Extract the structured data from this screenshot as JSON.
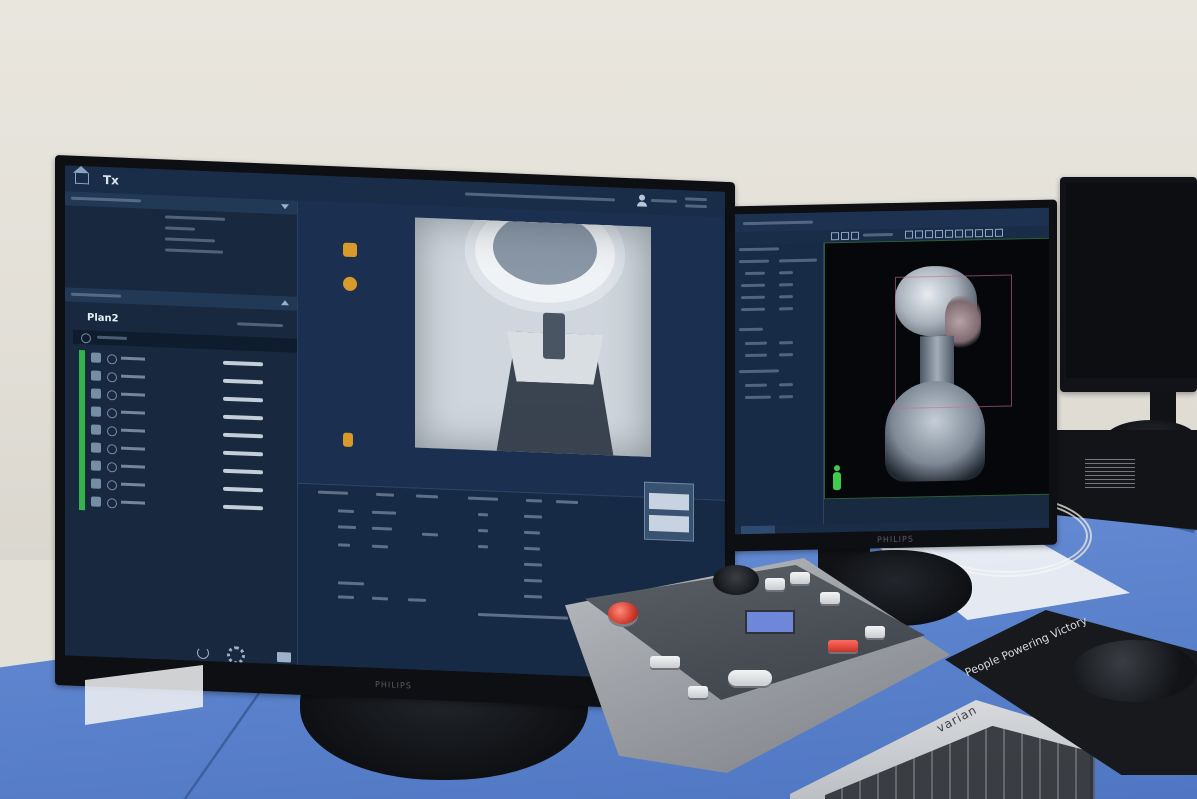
{
  "left_monitor": {
    "brand": "PHILIPS",
    "app": {
      "title": "Tx",
      "plan_label": "Plan2",
      "fields": [
        {
          "icon": "beam-icon"
        },
        {
          "icon": "beam-icon"
        },
        {
          "icon": "beam-icon"
        },
        {
          "icon": "beam-icon"
        },
        {
          "icon": "beam-icon"
        },
        {
          "icon": "beam-icon"
        },
        {
          "icon": "beam-icon"
        },
        {
          "icon": "beam-icon"
        },
        {
          "icon": "beam-icon"
        }
      ]
    },
    "side_icons": [
      "couch-icon",
      "person-icon",
      "lock-icon"
    ],
    "colors": {
      "panel_bg": "#16273f",
      "status_green": "#33b34a",
      "accent_orange": "#d99a2b"
    }
  },
  "right_monitor": {
    "brand": "PHILIPS",
    "app": {
      "viewer_content": "sagittal-xray-head-neck-thorax"
    },
    "colors": {
      "viewer_border": "#2f5e36",
      "roi": "#c96a8e",
      "person_icon": "#3fcc4d"
    }
  },
  "keyboard": {
    "brand": "varian"
  },
  "mousepad": {
    "text": "People Powering Victory"
  }
}
